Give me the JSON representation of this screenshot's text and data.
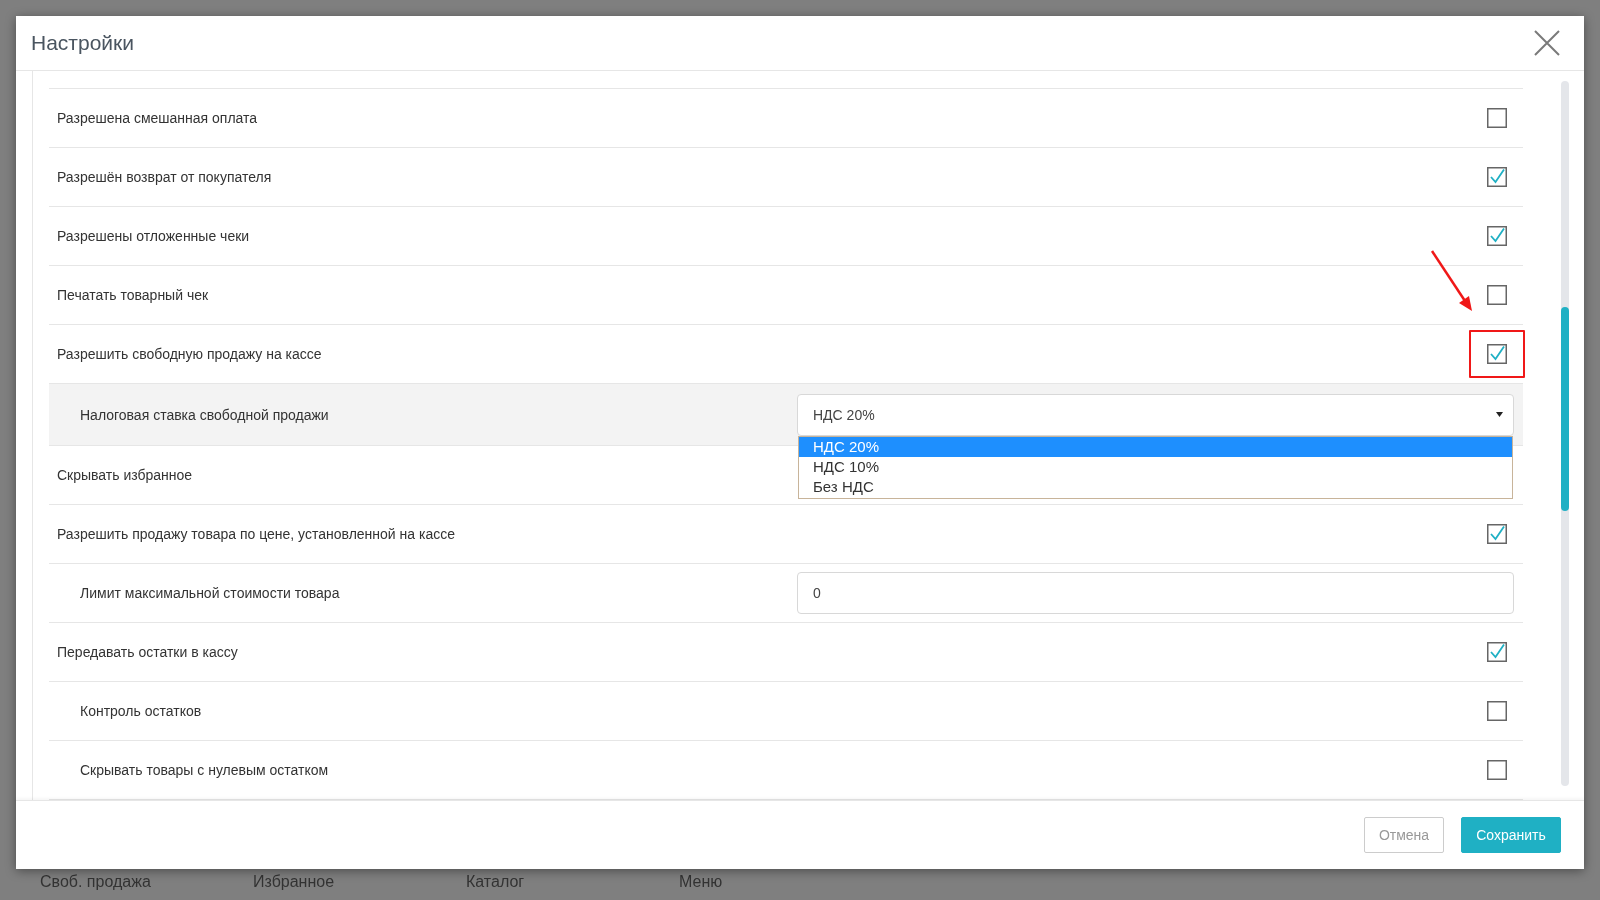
{
  "dialog": {
    "title": "Настройки"
  },
  "rows": [
    {
      "kind": "checkbox",
      "label": "Разрешена смешанная оплата",
      "checked": false,
      "highlighted": false
    },
    {
      "kind": "checkbox",
      "label": "Разрешён возврат от покупателя",
      "checked": true,
      "highlighted": false
    },
    {
      "kind": "checkbox",
      "label": "Разрешены отложенные чеки",
      "checked": true,
      "highlighted": false
    },
    {
      "kind": "checkbox",
      "label": "Печатать товарный чек",
      "checked": false,
      "highlighted": false
    },
    {
      "kind": "checkbox",
      "label": "Разрешить свободную продажу на кассе",
      "checked": true,
      "highlighted": true,
      "children": [
        {
          "kind": "select",
          "label": "Налоговая ставка свободной продажи",
          "value": "НДС 20%",
          "open": true,
          "options": [
            {
              "label": "НДС 20%",
              "selected": true
            },
            {
              "label": "НДС 10%",
              "selected": false
            },
            {
              "label": "Без НДС",
              "selected": false
            }
          ]
        }
      ]
    },
    {
      "kind": "label",
      "label": "Скрывать избранное",
      "highlighted": false
    },
    {
      "kind": "checkbox",
      "label": "Разрешить продажу товара по цене, установленной на кассе",
      "checked": true,
      "highlighted": false,
      "children": [
        {
          "kind": "input",
          "label": "Лимит максимальной стоимости товара",
          "value": "0"
        }
      ]
    },
    {
      "kind": "checkbox",
      "label": "Передавать остатки в кассу",
      "checked": true,
      "highlighted": false,
      "children": [
        {
          "kind": "checkbox",
          "label": "Контроль остатков",
          "checked": false
        },
        {
          "kind": "checkbox",
          "label": "Скрывать товары с нулевым остатком",
          "checked": false
        }
      ]
    }
  ],
  "buttons": [
    {
      "label": "Отмена",
      "kind": "secondary"
    },
    {
      "label": "Сохранить",
      "kind": "primary"
    }
  ],
  "background_tabs": [
    "Своб. продажа",
    "Избранное",
    "Каталог",
    "Меню"
  ]
}
